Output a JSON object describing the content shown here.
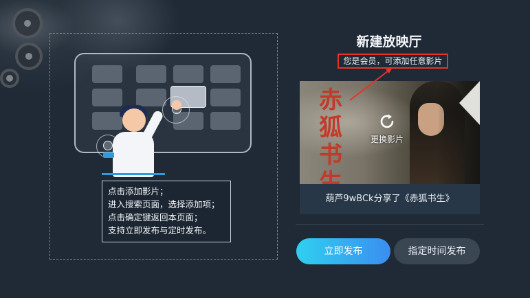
{
  "dialog": {
    "title": "新建放映厅",
    "member_note": "您是会员，可添加任意影片"
  },
  "instructions": {
    "lines": [
      "点击添加影片；",
      "进入搜索页面，选择添加项；",
      "点击确定键返回本页面；",
      "支持立即发布与定时发布。"
    ]
  },
  "movie": {
    "poster_title": "赤狐书生",
    "change_label": "更换影片",
    "share_text": "葫芦9wBCk分享了《赤狐书生》"
  },
  "buttons": {
    "publish_now": "立即发布",
    "schedule_publish": "指定时间发布"
  },
  "colors": {
    "accent_gradient_start": "#2fd0f0",
    "accent_gradient_end": "#3a8ef0",
    "highlight_red": "#e5332a",
    "background": "#1f2a36"
  },
  "icons": {
    "refresh": "refresh-icon",
    "annotation": "red-arrow-icon"
  }
}
